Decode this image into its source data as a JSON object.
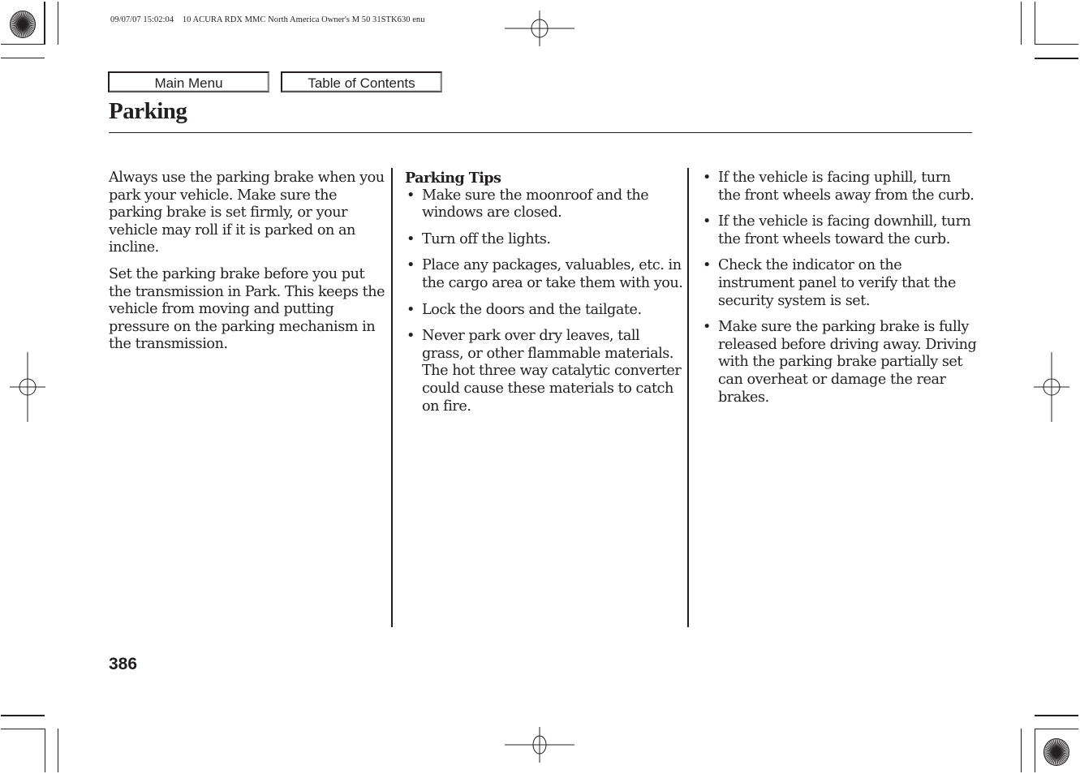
{
  "print_slug": "09/07/07 15:02:04    10 ACURA RDX MMC North America Owner's M 50 31STK630 enu",
  "nav": {
    "main_menu_label": "Main Menu",
    "toc_label": "Table of Contents"
  },
  "page": {
    "title": "Parking",
    "number": "386"
  },
  "intro": {
    "paragraphs": [
      "Always use the parking brake when you park your vehicle. Make sure the parking brake is set firmly, or your vehicle may roll if it is parked on an incline.",
      "Set the parking brake before you put the transmission in Park. This keeps the vehicle from moving and putting pressure on the parking mechanism in the transmission."
    ]
  },
  "tips": {
    "heading": "Parking Tips",
    "bullet_glyph": "•",
    "column_a": [
      "Make sure the moonroof and the windows are closed.",
      "Turn off the lights.",
      "Place any packages, valuables, etc. in the cargo area or take them with you.",
      "Lock the doors and the tailgate.",
      "Never park over dry leaves, tall grass, or other flammable materials. The hot three way catalytic converter could cause these materials to catch on fire."
    ],
    "column_b": [
      "If the vehicle is facing uphill, turn the front wheels away from the curb.",
      "If the vehicle is facing downhill, turn the front wheels toward the curb.",
      "Check the indicator on the instrument panel to verify that the security system is set.",
      "Make sure the parking brake is fully released before driving away. Driving with the parking brake partially set can overheat or damage the rear brakes."
    ]
  },
  "print_marks": {
    "icons": [
      "sunburst-registration-icon",
      "crosshair-registration-icon",
      "crop-mark-icon"
    ],
    "ink_color": "#231f20"
  }
}
